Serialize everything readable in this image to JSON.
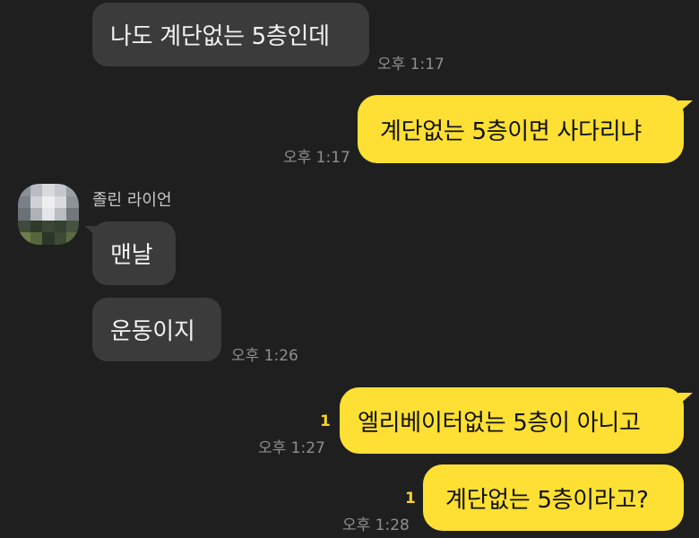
{
  "colors": {
    "background": "#1f1f1f",
    "incoming_bubble": "#3b3b3b",
    "outgoing_bubble": "#fde033",
    "unread_badge": "#f5d328",
    "timestamp": "#8f8f8f"
  },
  "messages": [
    {
      "direction": "incoming",
      "text": "나도 계단없는 5층인데",
      "time": "오후 1:17"
    },
    {
      "direction": "outgoing",
      "text": "계단없는 5층이면 사다리냐",
      "time": "오후 1:17"
    },
    {
      "direction": "incoming",
      "sender": "졸린 라이언",
      "avatar": "pixelated-profile-photo",
      "text": "맨날"
    },
    {
      "direction": "incoming",
      "text": "운동이지",
      "time": "오후 1:26"
    },
    {
      "direction": "outgoing",
      "text": "엘리베이터없는 5층이 아니고",
      "time": "오후 1:27",
      "unread": "1"
    },
    {
      "direction": "outgoing",
      "text": "계단없는 5층이라고?",
      "time": "오후 1:28",
      "unread": "1"
    }
  ]
}
